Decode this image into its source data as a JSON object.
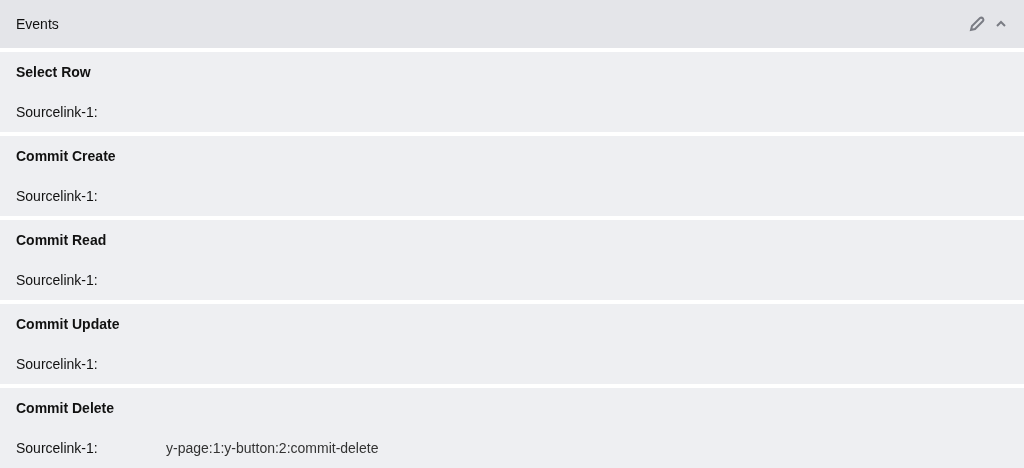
{
  "panel": {
    "title": "Events",
    "expanded": true
  },
  "events": [
    {
      "name": "Select Row",
      "label": "Sourcelink-1:"
    },
    {
      "name": "Commit Create",
      "label": "Sourcelink-1:"
    },
    {
      "name": "Commit Read",
      "label": "Sourcelink-1:"
    },
    {
      "name": "Commit Update",
      "label": "Sourcelink-1:"
    },
    {
      "name": "Commit Delete",
      "label": "Sourcelink-1:",
      "value": "y-page:1:y-button:2:commit-delete"
    }
  ]
}
